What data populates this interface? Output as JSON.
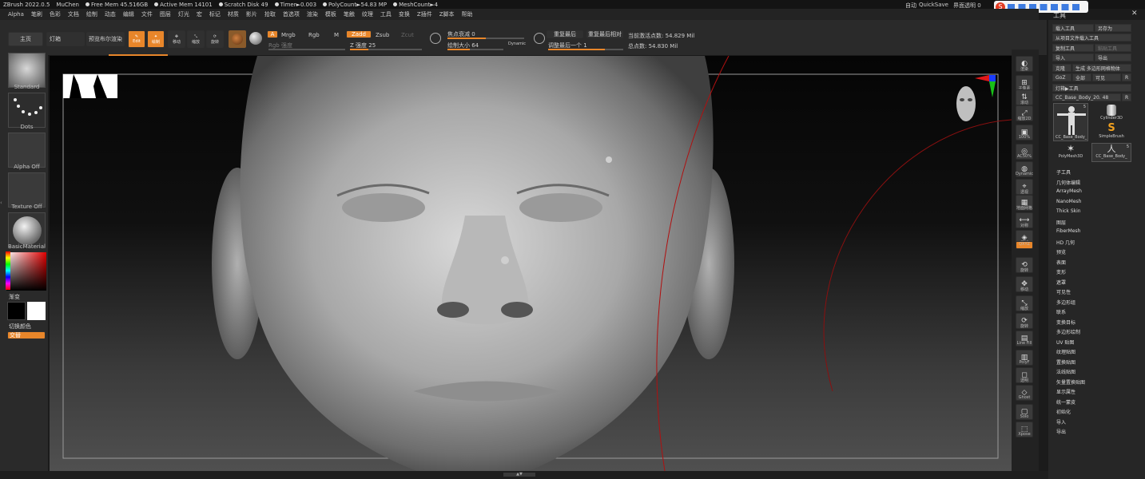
{
  "topbar": {
    "app": "ZBrush 2022.0.5",
    "user": "MuChen",
    "free_mem": "Free Mem 45.516GB",
    "active_mem": "Active Mem 14101",
    "scratch": "Scratch Disk 49",
    "timer": "Timer►0.003",
    "polycount": "PolyCount►54.83 MP",
    "meshcount": "MeshCount►4",
    "auto_label": "自动",
    "quicksave": "QuickSave",
    "transparency": "界面透明 0"
  },
  "menu": [
    "Alpha",
    "笔刷",
    "色彩",
    "文档",
    "绘制",
    "动态",
    "编辑",
    "文件",
    "图层",
    "灯光",
    "宏",
    "标记",
    "材质",
    "影片",
    "拾取",
    "首选项",
    "渲染",
    "模板",
    "笔触",
    "纹理",
    "工具",
    "变换",
    "Z插件",
    "Z脚本",
    "帮助"
  ],
  "toolbar": {
    "home": "主页",
    "lightbox": "灯箱",
    "preview_bpr": "预览布尔渲染",
    "edit": "Edit",
    "draw": "绘制",
    "move": "移动",
    "scale": "缩放",
    "rotate": "旋转",
    "a_btn": "A",
    "mrgb": "Mrgb",
    "rgb": "Rgb",
    "m": "M",
    "zadd": "Zadd",
    "zsub": "Zsub",
    "zcut": "Zcut",
    "rgb_intensity": "Rgb 强度",
    "z_intensity": "Z 强度 25",
    "focal_shift": "焦点衰减 0",
    "draw_size": "绘制大小 64",
    "dynamic": "Dynamic",
    "replay_last": "重复最后",
    "replay_last_rel": "重复最后相对",
    "adjust_last": "调整最后一个 1",
    "active_points": "当前激活点数: 54.829 Mil",
    "total_points": "总点数: 54.830 Mil"
  },
  "left": {
    "brush": "Standard",
    "stroke": "Dots",
    "alpha": "Alpha Off",
    "texture": "Texture Off",
    "material": "BasicMaterial",
    "gradient": "渐变",
    "switch_color": "切换颜色",
    "alternate": "交替"
  },
  "rightstrip": [
    "渲染",
    "子像素",
    "滚动",
    "缩放2D",
    "100%",
    "AC50%",
    "Dynamic",
    "透视",
    "地面网格",
    "对称",
    "局部",
    "QXYZ",
    "旋转",
    "移动",
    "缩放",
    "旋转",
    "Line Fill",
    "PolyF",
    "透明",
    "Ghost",
    "Solo",
    "Xpose"
  ],
  "tool_panel": {
    "title": "工具",
    "load_tool": "载入工具",
    "save_as": "另存为",
    "load_from_project": "从项目文件载入工具",
    "copy_tool": "复制工具",
    "paste_tool": "粘贴工具",
    "import": "导入",
    "export": "导出",
    "clone": "克隆",
    "make_polymesh": "生成 多边形网格物体",
    "goz": "GoZ",
    "all": "全部",
    "visible": "可见",
    "r": "R",
    "lightbox_tools": "灯箱▶工具",
    "current_tool": "CC_Base_Body_20. 48",
    "tools": [
      {
        "name": "CC_Base_Body_",
        "count": "5"
      },
      {
        "name": "Cylinder3D",
        "count": ""
      },
      {
        "name": "SimpleBrush",
        "count": ""
      },
      {
        "name": "PolyMesh3D",
        "count": ""
      },
      {
        "name": "CC_Base_Body_",
        "count": "5"
      }
    ],
    "subpalettes": [
      "子工具",
      "几何体编辑",
      "ArrayMesh",
      "NanoMesh",
      "Thick Skin",
      "图层",
      "FiberMesh",
      "HD 几何",
      "预览",
      "表面",
      "变形",
      "遮罩",
      "可见性",
      "多边形组",
      "联系",
      "变换目标",
      "多边形绘制",
      "UV 贴图",
      "纹理贴图",
      "置换贴图",
      "法线贴图",
      "矢量置换贴图",
      "显示属性",
      "统一蒙皮",
      "初始化",
      "导入",
      "导出"
    ]
  },
  "colors": {
    "accent": "#e8862a",
    "panel": "#2a2a2a",
    "viewport_top": "#050505"
  }
}
